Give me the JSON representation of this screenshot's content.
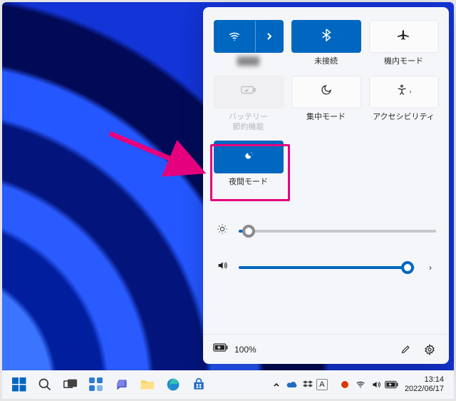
{
  "colors": {
    "accent": "#0067c0",
    "highlight": "#e5007e"
  },
  "panel": {
    "tiles": {
      "wifi": {
        "label": ""
      },
      "bluetooth": {
        "label": "未接続"
      },
      "airplane": {
        "label": "機内モード"
      },
      "battery": {
        "label": "バッテリー\n節約機能"
      },
      "focus": {
        "label": "集中モード"
      },
      "access": {
        "label": "アクセシビリティ"
      },
      "night": {
        "label": "夜間モード"
      }
    },
    "brightness": {
      "percent": 5
    },
    "volume": {
      "percent": 96
    },
    "battery_level": "100%"
  },
  "taskbar": {
    "time": "13:14",
    "date": "2022/06/17"
  }
}
